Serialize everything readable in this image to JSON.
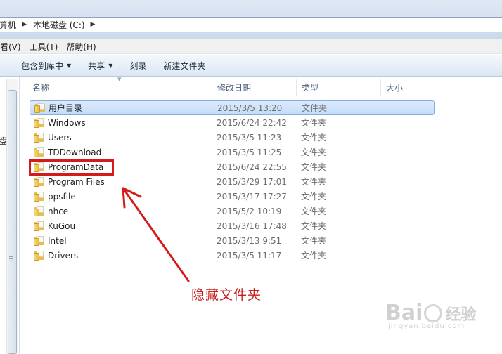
{
  "address": {
    "crumbs": [
      "算机",
      "本地磁盘 (C:)"
    ],
    "separator": "▶"
  },
  "menu": [
    "看(V)",
    "工具(T)",
    "帮助(H)"
  ],
  "toolbar": {
    "include_library": "包含到库中",
    "share": "共享",
    "burn": "刻录",
    "new_folder": "新建文件夹"
  },
  "nav": {
    "fragment": "盘"
  },
  "columns": {
    "name": "名称",
    "date": "修改日期",
    "type": "类型",
    "size": "大小"
  },
  "files": [
    {
      "name": "用户目录",
      "date": "2015/3/5 13:20",
      "type": "文件夹"
    },
    {
      "name": "Windows",
      "date": "2015/6/24 22:42",
      "type": "文件夹"
    },
    {
      "name": "Users",
      "date": "2015/3/5 11:23",
      "type": "文件夹"
    },
    {
      "name": "TDDownload",
      "date": "2015/3/5 11:25",
      "type": "文件夹"
    },
    {
      "name": "ProgramData",
      "date": "2015/6/24 22:55",
      "type": "文件夹"
    },
    {
      "name": "Program Files",
      "date": "2015/3/29 17:01",
      "type": "文件夹"
    },
    {
      "name": "ppsfile",
      "date": "2015/3/17 17:27",
      "type": "文件夹"
    },
    {
      "name": "nhce",
      "date": "2015/5/2 10:19",
      "type": "文件夹"
    },
    {
      "name": "KuGou",
      "date": "2015/3/16 17:48",
      "type": "文件夹"
    },
    {
      "name": "Intel",
      "date": "2015/3/13 9:51",
      "type": "文件夹"
    },
    {
      "name": "Drivers",
      "date": "2015/3/5 11:17",
      "type": "文件夹"
    }
  ],
  "annotation": {
    "label": "隐藏文件夹",
    "color": "#d41b1b"
  },
  "watermark": {
    "logo_a": "Bai",
    "logo_b": "经验",
    "url": "jingyan.baidu.com"
  },
  "colors": {
    "selection": "#c3dcfa",
    "accent": "#d41b1b"
  }
}
